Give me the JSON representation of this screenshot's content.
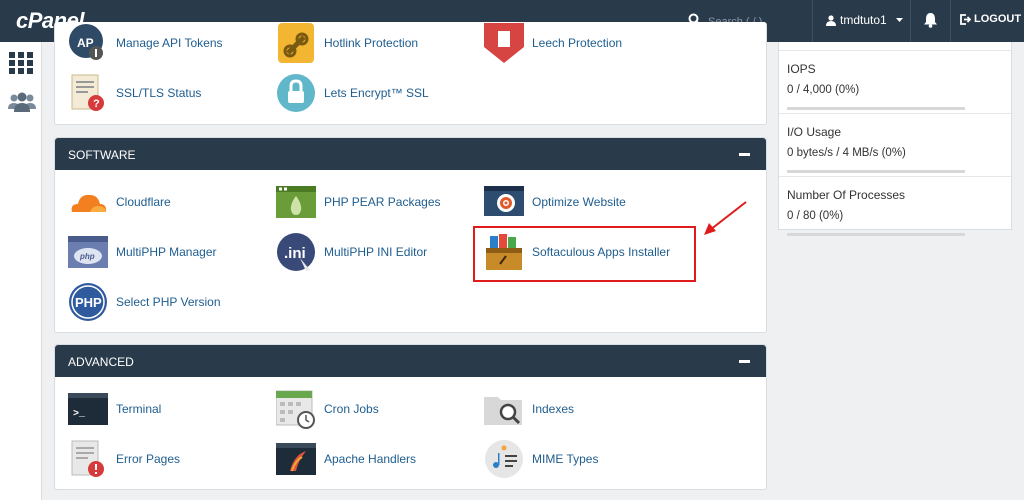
{
  "header": {
    "logo": "cPanel",
    "search_placeholder": "Search ( / )",
    "username": "tmdtuto1",
    "logout_label": "LOGOUT"
  },
  "security_tail": {
    "items": [
      {
        "label": "Manage API Tokens",
        "icon": "api-tokens-icon"
      },
      {
        "label": "Hotlink Protection",
        "icon": "hotlink-icon"
      },
      {
        "label": "Leech Protection",
        "icon": "leech-icon"
      },
      {
        "label": "SSL/TLS Status",
        "icon": "ssl-status-icon"
      },
      {
        "label": "Lets Encrypt™ SSL",
        "icon": "lets-encrypt-icon"
      }
    ]
  },
  "software": {
    "title": "SOFTWARE",
    "items": [
      {
        "label": "Cloudflare",
        "icon": "cloudflare-icon"
      },
      {
        "label": "PHP PEAR Packages",
        "icon": "php-pear-icon"
      },
      {
        "label": "Optimize Website",
        "icon": "optimize-icon"
      },
      {
        "label": "MultiPHP Manager",
        "icon": "multiphp-manager-icon"
      },
      {
        "label": "MultiPHP INI Editor",
        "icon": "ini-editor-icon"
      },
      {
        "label": "Softaculous Apps Installer",
        "icon": "softaculous-icon"
      },
      {
        "label": "Select PHP Version",
        "icon": "php-version-icon"
      }
    ]
  },
  "advanced": {
    "title": "ADVANCED",
    "items": [
      {
        "label": "Terminal",
        "icon": "terminal-icon"
      },
      {
        "label": "Cron Jobs",
        "icon": "cron-icon"
      },
      {
        "label": "Indexes",
        "icon": "indexes-icon"
      },
      {
        "label": "Error Pages",
        "icon": "error-pages-icon"
      },
      {
        "label": "Apache Handlers",
        "icon": "apache-icon"
      },
      {
        "label": "MIME Types",
        "icon": "mime-icon"
      }
    ]
  },
  "stats": [
    {
      "name": "IOPS",
      "value": "0 / 4,000   (0%)",
      "fraction": 0
    },
    {
      "name": "I/O Usage",
      "value": "0 bytes/s / 4 MB/s   (0%)",
      "fraction": 0
    },
    {
      "name": "Number Of Processes",
      "value": "0 / 80   (0%)",
      "fraction": 0
    }
  ],
  "colors": {
    "header_bg": "#293a4a",
    "link": "#1e5d8f",
    "highlight": "#e01b1b"
  }
}
